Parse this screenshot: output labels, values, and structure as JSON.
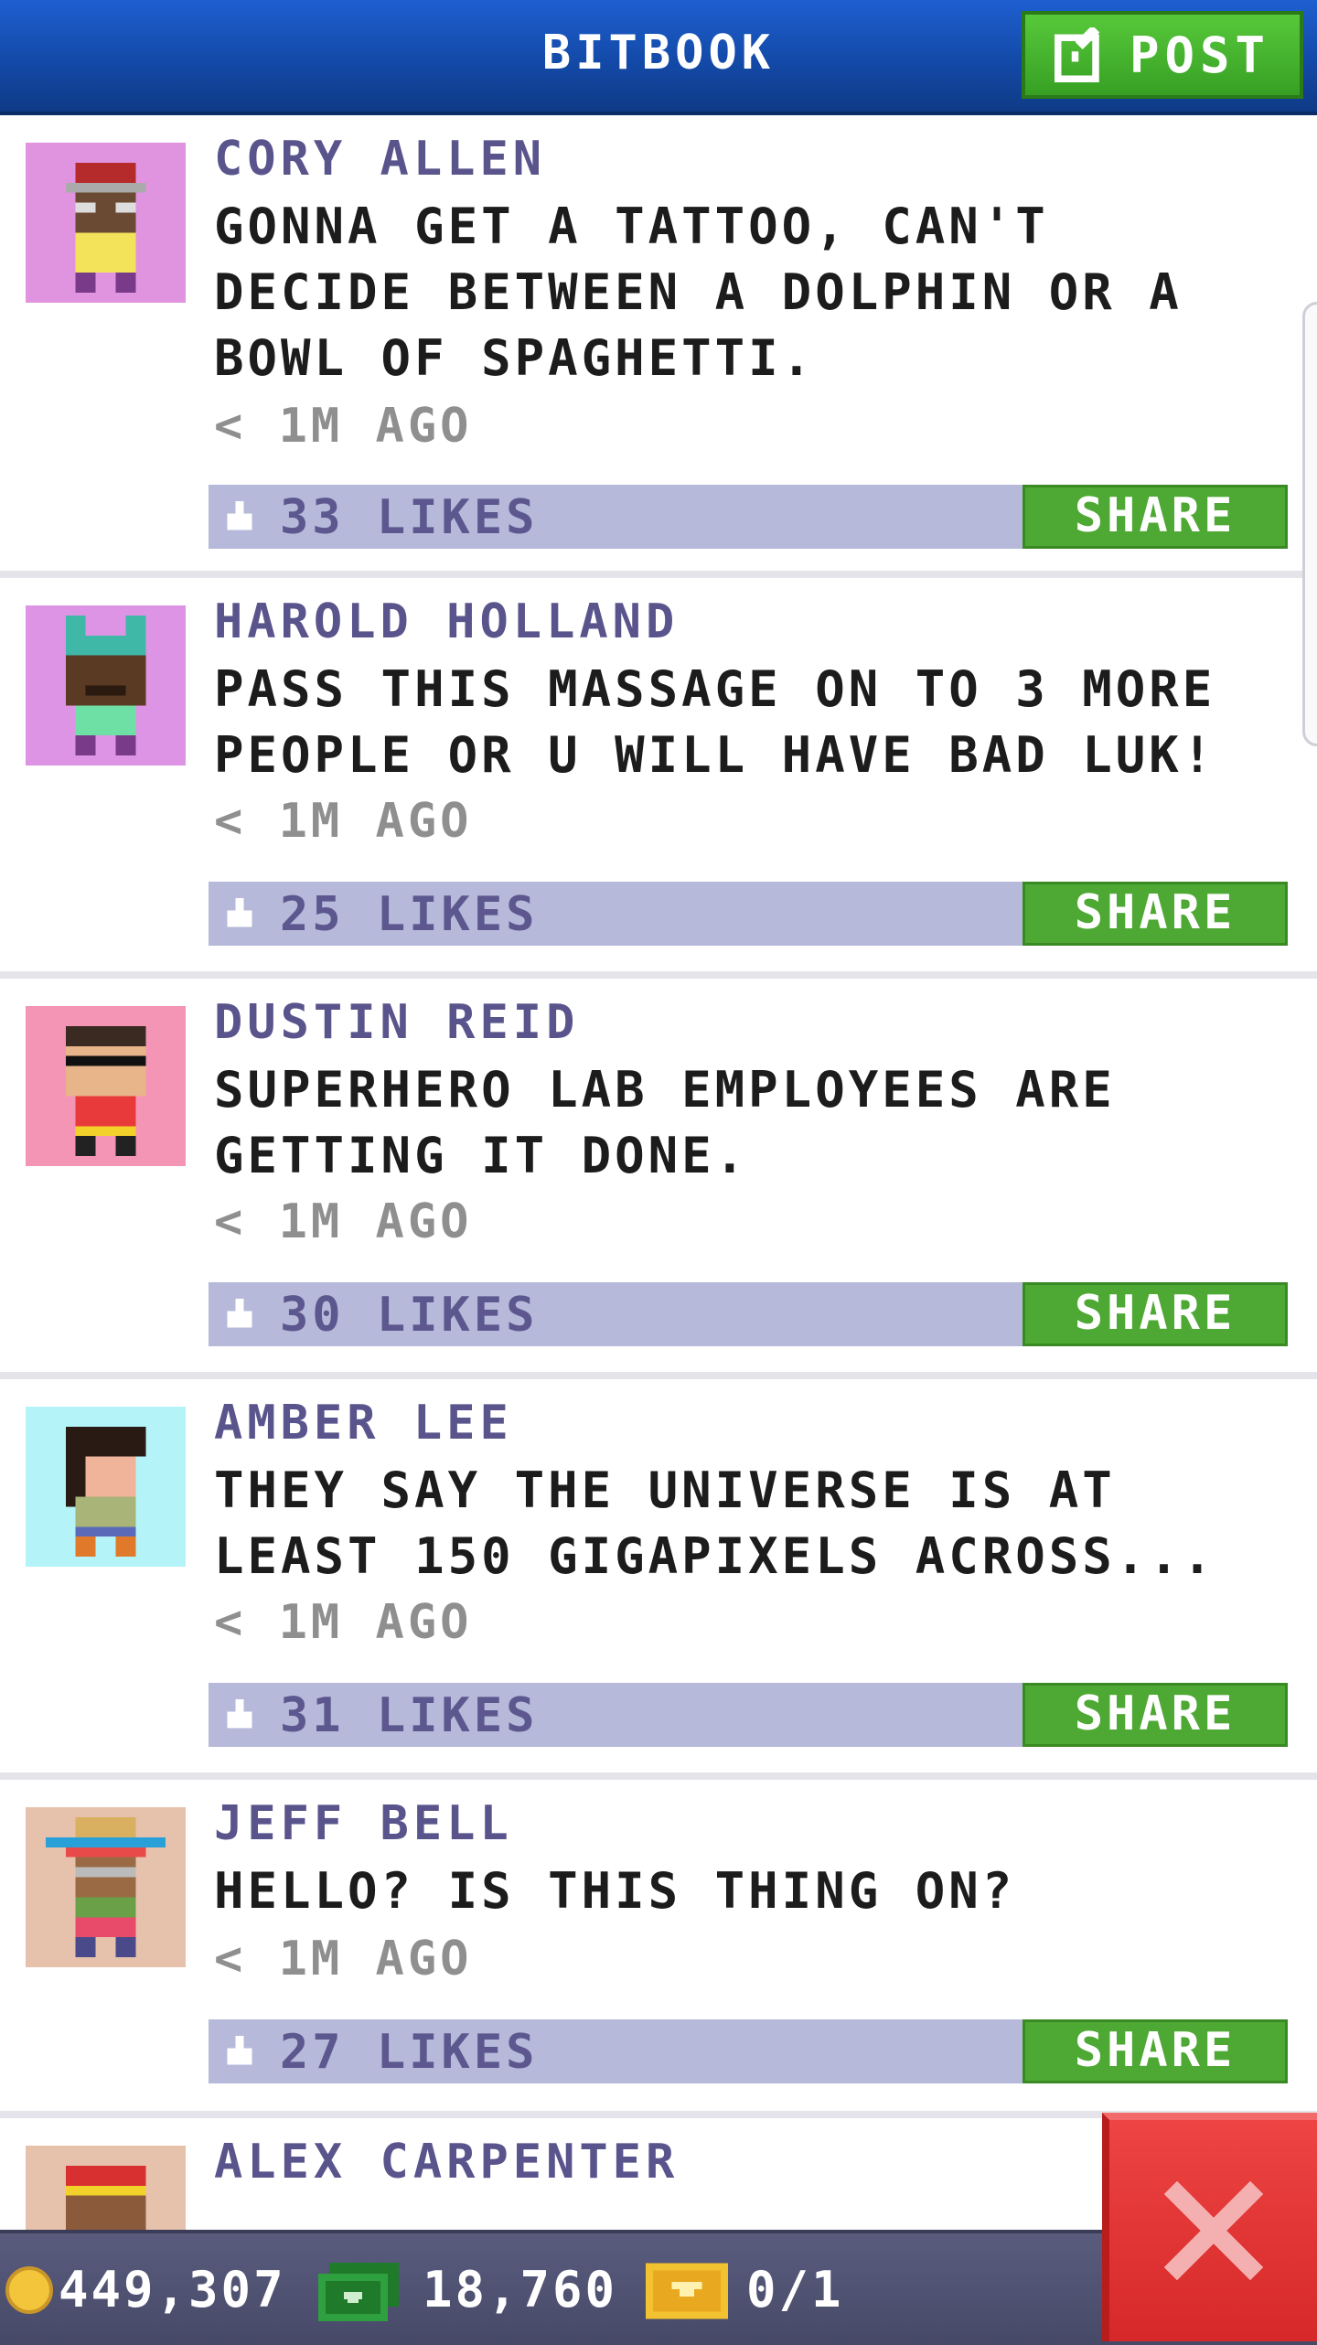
{
  "header": {
    "title": "BITBOOK",
    "post_label": "POST"
  },
  "posts": [
    {
      "name": "CORY ALLEN",
      "message": "GONNA GET A TATTOO, CAN'T DECIDE BETWEEN A DOLPHIN OR A BOWL OF SPAGHETTI.",
      "time": "< 1M AGO",
      "likes": "33 LIKES",
      "share": "SHARE",
      "avatar_bg": "#e094e0"
    },
    {
      "name": "HAROLD HOLLAND",
      "message": "PASS THIS MASSAGE ON TO 3 MORE PEOPLE OR U WILL HAVE BAD LUK!",
      "time": "< 1M AGO",
      "likes": "25 LIKES",
      "share": "SHARE",
      "avatar_bg": "#dd94e4"
    },
    {
      "name": "DUSTIN REID",
      "message": "SUPERHERO LAB EMPLOYEES ARE GETTING IT DONE.",
      "time": "< 1M AGO",
      "likes": "30 LIKES",
      "share": "SHARE",
      "avatar_bg": "#f595b5"
    },
    {
      "name": "AMBER LEE",
      "message": "THEY SAY THE UNIVERSE IS AT LEAST 150 GIGAPIXELS ACROSS...",
      "time": "< 1M AGO",
      "likes": "31 LIKES",
      "share": "SHARE",
      "avatar_bg": "#b4f4f8"
    },
    {
      "name": "JEFF BELL",
      "message": "HELLO? IS THIS THING ON?",
      "time": "< 1M AGO",
      "likes": "27 LIKES",
      "share": "SHARE",
      "avatar_bg": "#e6c2ac"
    },
    {
      "name": "ALEX CARPENTER",
      "avatar_bg": "#e6c2ac"
    }
  ],
  "status": {
    "coins": "449,307",
    "cash": "18,760",
    "tickets": "0/1"
  },
  "colors": {
    "header_blue": "#1a55c0",
    "post_green": "#4caf32",
    "likes_bar": "#b6b9d9",
    "name_color": "#5a548c",
    "close_red": "#e03a3a"
  }
}
